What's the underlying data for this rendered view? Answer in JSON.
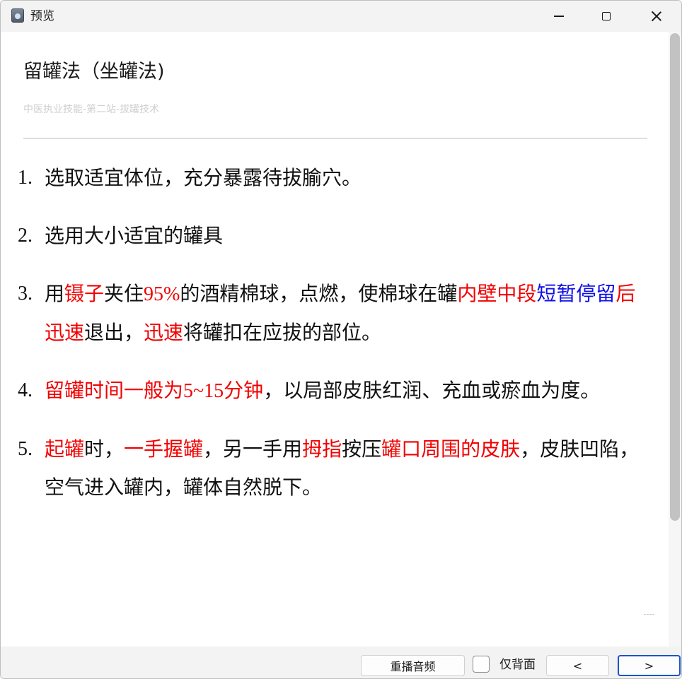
{
  "window": {
    "title": "预览"
  },
  "page": {
    "title": "留罐法（坐罐法)",
    "subtitle": "中医执业技能-第二站-拔罐技术"
  },
  "steps": [
    {
      "number": "1.",
      "segments": [
        {
          "text": "选取适宜体位，充分暴露待拔腧穴。",
          "color": "black"
        }
      ]
    },
    {
      "number": "2.",
      "segments": [
        {
          "text": "选用大小适宜的罐具",
          "color": "black"
        }
      ]
    },
    {
      "number": "3.",
      "segments": [
        {
          "text": "用",
          "color": "black"
        },
        {
          "text": "镊子",
          "color": "red"
        },
        {
          "text": "夹住",
          "color": "black"
        },
        {
          "text": "95%",
          "color": "red",
          "numeric": true
        },
        {
          "text": "的酒精棉球，点燃，使棉球在罐",
          "color": "black"
        },
        {
          "text": "内壁中段",
          "color": "red"
        },
        {
          "text": "短暂停留",
          "color": "blue"
        },
        {
          "text": "后迅速",
          "color": "red"
        },
        {
          "text": "退出，",
          "color": "black"
        },
        {
          "text": "迅速",
          "color": "red"
        },
        {
          "text": "将罐扣在应拔的部位。",
          "color": "black"
        }
      ]
    },
    {
      "number": "4.",
      "segments": [
        {
          "text": "留罐时间一般为",
          "color": "red"
        },
        {
          "text": "5~15",
          "color": "red",
          "numeric": true
        },
        {
          "text": "分钟",
          "color": "red"
        },
        {
          "text": "，以局部皮肤红润、充血或瘀血为度。",
          "color": "black"
        }
      ]
    },
    {
      "number": "5.",
      "segments": [
        {
          "text": "起罐",
          "color": "red"
        },
        {
          "text": "时，",
          "color": "black"
        },
        {
          "text": "一手握罐",
          "color": "red"
        },
        {
          "text": "，另一手用",
          "color": "black"
        },
        {
          "text": "拇指",
          "color": "red"
        },
        {
          "text": "按压",
          "color": "black"
        },
        {
          "text": "罐口周围的皮肤",
          "color": "red"
        },
        {
          "text": "，皮肤凹陷，空气进入罐内，罐体自然脱下。",
          "color": "black"
        }
      ]
    }
  ],
  "toolbar": {
    "replay_label": "重播音频",
    "back_only_label": "仅背面",
    "back_only_checked": false,
    "prev_label": "<",
    "next_label": ">"
  },
  "colors": {
    "red": "#f20000",
    "blue": "#1010e8",
    "black": "#111111",
    "accent": "#1a56c9"
  },
  "icons": {
    "app": "app-icon",
    "minimize": "minimize-icon",
    "maximize": "maximize-icon",
    "close": "close-icon"
  }
}
